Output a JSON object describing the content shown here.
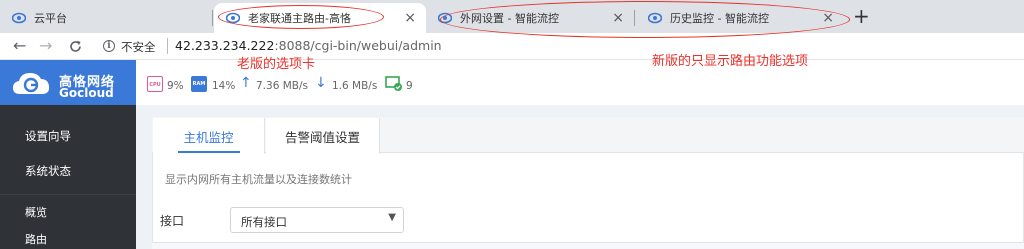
{
  "browser": {
    "tabs": [
      {
        "title": "云平台",
        "active": false
      },
      {
        "title": "老家联通主路由-高恪",
        "active": true
      },
      {
        "title": "外网设置 - 智能流控",
        "active": false
      },
      {
        "title": "历史监控 - 智能流控",
        "active": false
      }
    ],
    "new_tab_label": "+",
    "close_glyph": "×",
    "address": {
      "security_label": "不安全",
      "url_host": "42.233.234.222",
      "url_rest": ":8088/cgi-bin/webui/admin"
    }
  },
  "app": {
    "brand_cn": "高恪网络",
    "brand_en": "Gocloud",
    "brand_color": "#3b79d8",
    "stats": {
      "cpu_chip": "CPU",
      "cpu": "9%",
      "ram_chip": "RAM",
      "ram": "14%",
      "upload": "7.36 MB/s",
      "download": "1.6 MB/s",
      "devices": "9"
    },
    "sidebar": {
      "items": [
        "设置向导",
        "系统状态"
      ],
      "sub_items": [
        "概览",
        "路由"
      ]
    },
    "content": {
      "tabs": [
        "主机监控",
        "告警阈值设置"
      ],
      "description": "显示内网所有主机流量以及连接数统计",
      "interface_label": "接口",
      "interface_value": "所有接口"
    }
  },
  "annotations": {
    "old_tab": "老版的选项卡",
    "new_tabs": "新版的只显示路由功能选项",
    "color": "#e8322c"
  }
}
